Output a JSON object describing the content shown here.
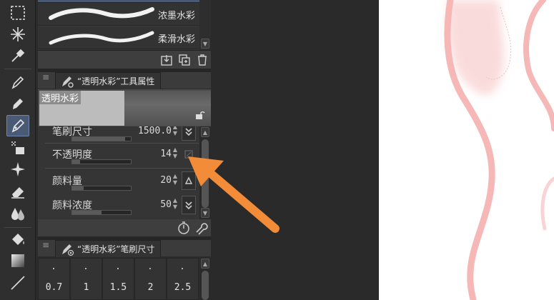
{
  "brush_list": {
    "items": [
      {
        "name": "浓墨水彩"
      },
      {
        "name": "柔滑水彩"
      }
    ]
  },
  "tool_property_panel": {
    "title": "“透明水彩”工具属性",
    "preview_label": "透明水彩",
    "properties": [
      {
        "label": "笔刷尺寸",
        "value": "1500.0",
        "slider_fraction": 0.9
      },
      {
        "label": "不透明度",
        "value": "14",
        "slider_fraction": 0.14
      },
      {
        "label": "颜料量",
        "value": "20",
        "slider_fraction": 0.2
      },
      {
        "label": "颜料浓度",
        "value": "50",
        "slider_fraction": 0.5
      }
    ]
  },
  "brush_size_panel": {
    "title": "“透明水彩”笔刷尺寸",
    "sizes": [
      "0.7",
      "1",
      "1.5",
      "2",
      "2.5"
    ]
  },
  "colors": {
    "accent_arrow": "#f28c38",
    "canvas_stroke": "#f6b7b7",
    "panel_bg": "#353535",
    "active_tool": "#4a5a74"
  }
}
